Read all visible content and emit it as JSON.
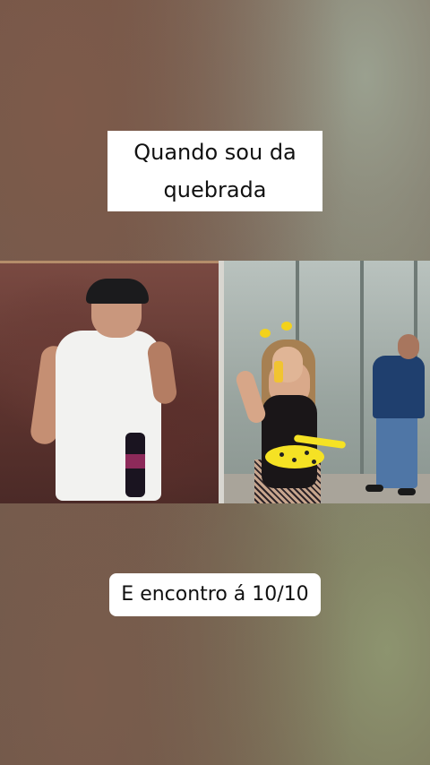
{
  "captions": {
    "top_line1": "Quando sou da",
    "top_line2": "quebrada",
    "bottom": "E encontro á 10/10"
  },
  "colors": {
    "caption_bg": "#ffffff",
    "caption_text": "#111111"
  }
}
